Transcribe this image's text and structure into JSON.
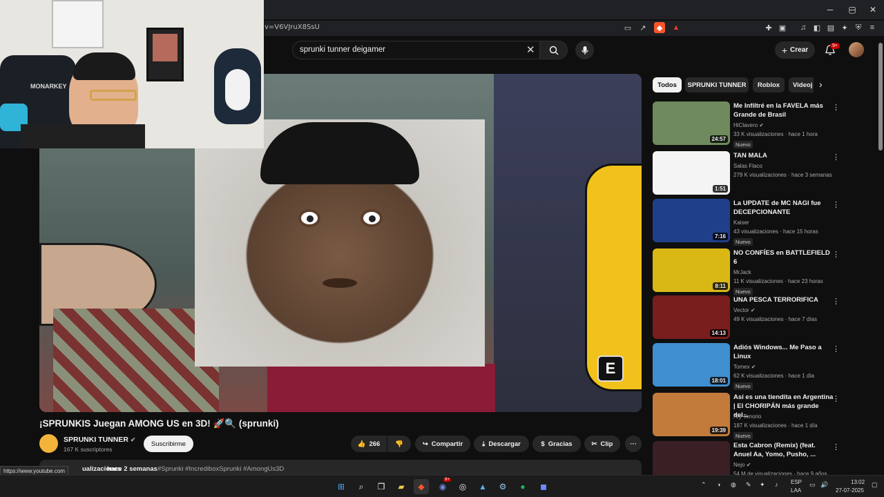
{
  "browser": {
    "url": "v=V6VJruX8SsU",
    "window_controls": {
      "minimize": "─",
      "maximize": "▢",
      "close": "✕"
    },
    "status_url": "https://www.youtube.com"
  },
  "header": {
    "search_query": "sprunki tunner deigamer",
    "create_label": "Crear",
    "notif_badge": "9+"
  },
  "video": {
    "title": "¡SPRUNKIS Juegan AMONG US en 3D! 🚀🔍 (sprunki)",
    "overlay_key": "E",
    "channel_name": "SPRUNKI TUNNER",
    "subscribers": "167 K suscriptores",
    "subscribe_label": "Suscribirme",
    "likes": "266",
    "share_label": "Compartir",
    "download_label": "Descargar",
    "thanks_label": "Gracias",
    "clip_label": "Clip",
    "more_label": "···",
    "desc_views_fragment": "ualizaciones",
    "desc_date": "hace 2 semanas",
    "desc_tags": "#Sprunki #IncrediboxSprunki #AmongUs3D"
  },
  "chips": [
    "Todos",
    "SPRUNKI TUNNER",
    "Roblox",
    "Videoj"
  ],
  "sidebar": [
    {
      "title": "Me Infiltré en la FAVELA más Grande de Brasil",
      "channel": "HiClavero",
      "verified": true,
      "meta": "33 K visualizaciones · hace 1 hora",
      "badge": "Nuevo",
      "duration": "24:57",
      "thumb_color": "#6f8a5c"
    },
    {
      "title": "TAN MALA",
      "channel": "Salas Flaco",
      "verified": false,
      "meta": "279 K visualizaciones · hace 3 semanas",
      "badge": "",
      "duration": "1:51",
      "thumb_color": "#f4f4f4"
    },
    {
      "title": "La UPDATE de MC NAGI fue DECEPCIONANTE",
      "channel": "Kaiser",
      "verified": false,
      "meta": "43 visualizaciones · hace 15 horas",
      "badge": "Nuevo",
      "duration": "7:16",
      "thumb_color": "#1f3f8a"
    },
    {
      "title": "NO CONFÍES en BATTLEFIELD 6",
      "channel": "MrJack",
      "verified": false,
      "meta": "11 K visualizaciones · hace 23 horas",
      "badge": "Nuevo",
      "duration": "8:11",
      "thumb_color": "#d9b816"
    },
    {
      "title": "UNA PESCA TERRORIFICA",
      "channel": "Vector",
      "verified": true,
      "meta": "49 K visualizaciones · hace 7 días",
      "badge": "",
      "duration": "14:13",
      "thumb_color": "#7a1d1d"
    },
    {
      "title": "Adiós Windows... Me Paso a Linux",
      "channel": "Tomex",
      "verified": true,
      "meta": "62 K visualizaciones · hace 1 día",
      "badge": "Nuevo",
      "duration": "18:01",
      "thumb_color": "#3f8fd1"
    },
    {
      "title": "Así es una tiendita en Argentina | El CHORIPÁN más grande del...",
      "channel": "Ary Tenorio",
      "verified": false,
      "meta": "187 K visualizaciones · hace 1 día",
      "badge": "Nuevo",
      "duration": "19:39",
      "thumb_color": "#c27b3b"
    },
    {
      "title": "Esta Cabron (Remix) (feat. Anuel Aa, Yomo, Pusho, ...",
      "channel": "Nejo",
      "verified": true,
      "meta": "54 M de visualizaciones · hace 9 años",
      "badge": "",
      "duration": "",
      "thumb_color": "#3a1f24"
    }
  ],
  "taskbar": {
    "lang1": "ESP",
    "lang2": "LAA",
    "time": "13:02",
    "date": "27-07-2025",
    "discord_badge": "9+"
  }
}
